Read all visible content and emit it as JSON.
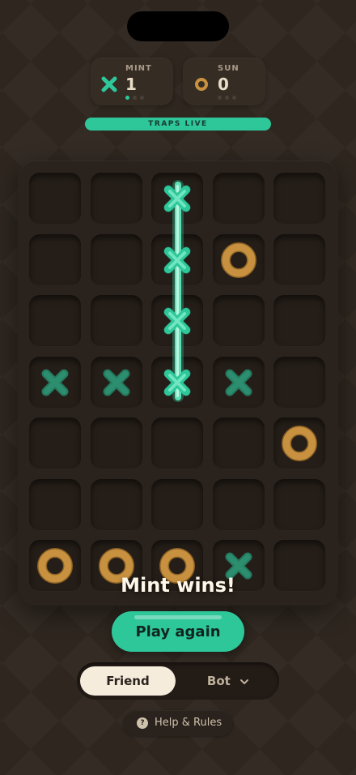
{
  "players": [
    {
      "label": "MINT",
      "score": "1",
      "icon": "x-mark-icon",
      "color": "#2fc69a"
    },
    {
      "label": "SUN",
      "score": "0",
      "icon": "o-ring-icon",
      "color": "#c8913f"
    }
  ],
  "round_indicator": {
    "mint_filled": 1,
    "sun_filled": 0,
    "total": 3
  },
  "status_banner": "TRAPS LIVE",
  "board": {
    "rows": 7,
    "cols": 5,
    "cells": [
      [
        "",
        "",
        "X",
        "",
        ""
      ],
      [
        "",
        "",
        "X",
        "O",
        ""
      ],
      [
        "",
        "",
        "X",
        "",
        ""
      ],
      [
        "X",
        "X",
        "X",
        "X",
        ""
      ],
      [
        "",
        "",
        "",
        "",
        "O"
      ],
      [
        "",
        "",
        "",
        "",
        ""
      ],
      [
        "O",
        "O",
        "O",
        "X",
        ""
      ]
    ],
    "winning_line": {
      "player": "X",
      "column": 3,
      "from_row": 1,
      "to_row": 4
    }
  },
  "result_text": "Mint wins!",
  "play_again_label": "Play again",
  "mode": {
    "options": [
      "Friend",
      "Bot"
    ],
    "selected": "Friend"
  },
  "help_label": "Help & Rules",
  "colors": {
    "mint": "#2ec79a",
    "sun": "#c8913f",
    "background": "#2e261f"
  }
}
